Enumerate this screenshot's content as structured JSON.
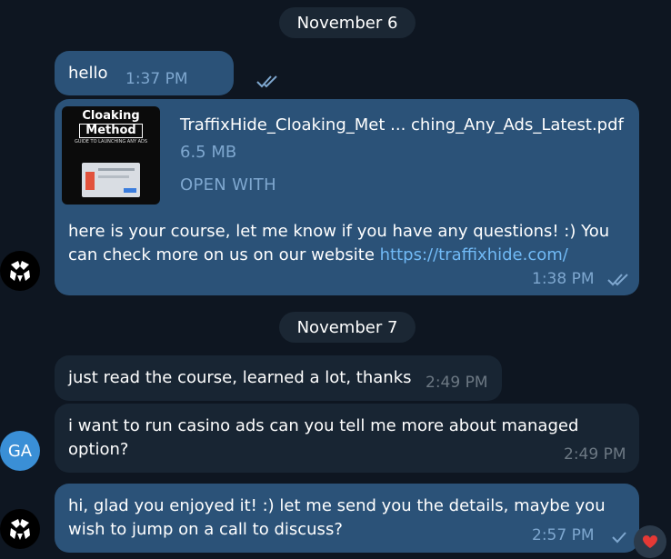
{
  "dates": {
    "first": "November 6",
    "second": "November 7"
  },
  "messages": [
    {
      "direction": "outgoing",
      "text": "hello",
      "time": "1:37 PM",
      "status": "read"
    },
    {
      "direction": "outgoing",
      "file": {
        "name": "TraffixHide_Cloaking_Met ... ching_Any_Ads_Latest.pdf",
        "size": "6.5 MB",
        "action": "OPEN WITH",
        "thumbnail_title_line1": "Cloaking",
        "thumbnail_title_line2": "Method",
        "thumbnail_subtitle": "GUIDE TO LAUNCHING ANY ADS"
      },
      "text_part1": "here is your course, let me know if you have any questions! :) You",
      "text_part2": "can check more on us on our website ",
      "link": "https://traffixhide.com/",
      "time": "1:38 PM",
      "status": "read"
    },
    {
      "direction": "incoming",
      "text": "just read the course, learned a lot, thanks",
      "time": "2:49 PM"
    },
    {
      "direction": "incoming",
      "text_line1": "i want to run casino ads can you tell me more about managed",
      "text_line2": "option?",
      "time": "2:49 PM"
    },
    {
      "direction": "outgoing",
      "text_line1": "hi, glad you enjoyed it! :) let me send you the details, maybe you",
      "text_line2": "wish to jump on a call to discuss?",
      "time": "2:57 PM",
      "status": "sent"
    }
  ],
  "avatars": {
    "user_initials": "GA",
    "brand_icon": "traffixhide-logo-icon"
  },
  "reaction": {
    "emoji": "❤️",
    "icon": "heart-icon"
  },
  "colors": {
    "background": "#0e1621",
    "outgoing_bubble": "#2b5278",
    "incoming_bubble": "#182533",
    "link": "#71baf6",
    "avatar_ga": "#3a8fd6"
  }
}
